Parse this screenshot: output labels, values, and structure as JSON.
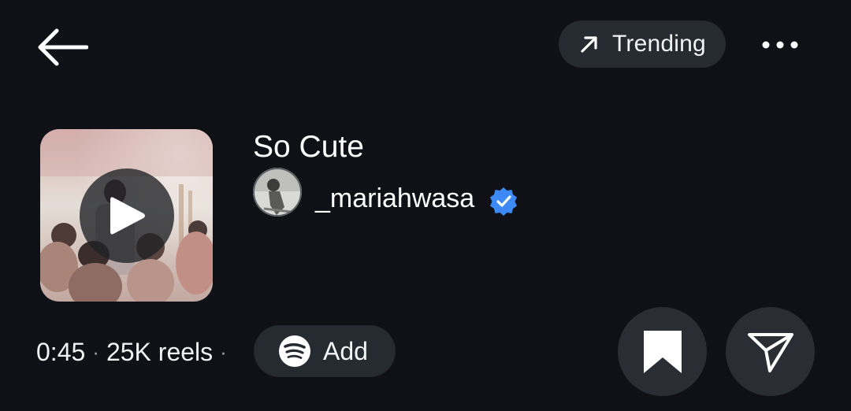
{
  "header": {
    "back_icon": "arrow-left-icon",
    "trending_label": "Trending",
    "trending_icon": "arrow-up-right-icon",
    "more_icon": "more-horizontal-icon"
  },
  "audio": {
    "title": "So Cute",
    "artist": "_mariahwasa",
    "verified": true,
    "verified_color": "#3d8af7",
    "duration": "0:45",
    "reels_count": "25K reels",
    "separator": "·"
  },
  "actions": {
    "add_label": "Add",
    "add_icon": "spotify-icon",
    "save_icon": "bookmark-icon",
    "share_icon": "send-icon"
  },
  "colors": {
    "background": "#0f1117",
    "chip_bg": "#262a31",
    "circle_button_bg": "#2a2d33",
    "text": "#ffffff"
  }
}
